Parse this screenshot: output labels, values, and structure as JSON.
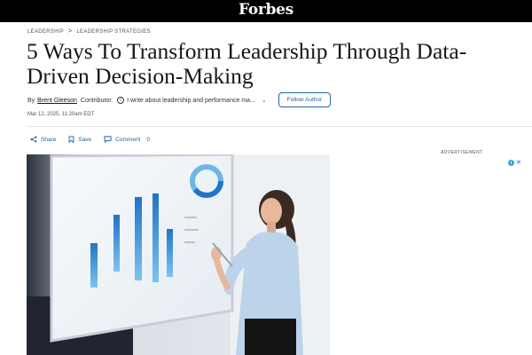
{
  "brand": {
    "name": "Forbes"
  },
  "breadcrumb": {
    "section": "LEADERSHIP",
    "subsection": "LEADERSHIP STRATEGIES",
    "separator": ">"
  },
  "article": {
    "headline": "5 Ways To Transform Leadership Through Data-Driven Decision-Making",
    "byline_prefix": "By",
    "author": "Brent Gleeson",
    "author_role": "Contributor.",
    "author_bio": "I write about leadership and performance ma...",
    "follow_label": "Follow Author",
    "date": "Mar 12, 2025, 11:20am EDT"
  },
  "actions": {
    "share_label": "Share",
    "save_label": "Save",
    "comment_label": "Comment",
    "comment_count": "0"
  },
  "sidebar": {
    "ad_label": "ADVERTISEMENT"
  },
  "colors": {
    "accent": "#2563a6",
    "topbar": "#000000",
    "ad_choice": "#2aa6df"
  },
  "icons": {
    "share": "share-icon",
    "save": "bookmark-icon",
    "comment": "comment-icon",
    "info": "info-icon",
    "chevron": "chevron-down-icon",
    "ad_choices": "adchoices-icon",
    "ad_close": "close-icon"
  }
}
